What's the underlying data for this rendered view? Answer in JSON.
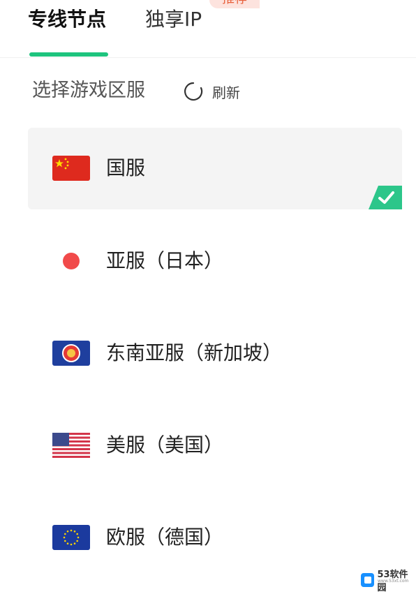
{
  "tabs": [
    {
      "label": "专线节点",
      "active": true
    },
    {
      "label": "独享IP",
      "active": false,
      "badge": "推荐"
    }
  ],
  "section": {
    "title": "选择游戏区服",
    "refresh_label": "刷新"
  },
  "servers": [
    {
      "label": "国服",
      "flag": "china-flag",
      "selected": true
    },
    {
      "label": "亚服（日本）",
      "flag": "japan-dot",
      "selected": false
    },
    {
      "label": "东南亚服（新加坡）",
      "flag": "asean-flag",
      "selected": false
    },
    {
      "label": "美服（美国）",
      "flag": "usa-flag",
      "selected": false
    },
    {
      "label": "欧服（德国）",
      "flag": "eu-flag",
      "selected": false
    }
  ],
  "watermark": {
    "logo_text": "53软件园",
    "url_text": "www.53xt.com"
  },
  "colors": {
    "accent": "#1ec47e",
    "badge_text": "#e8603b",
    "badge_bg": "#fde3de",
    "selected_bg": "#f4f4f4"
  }
}
